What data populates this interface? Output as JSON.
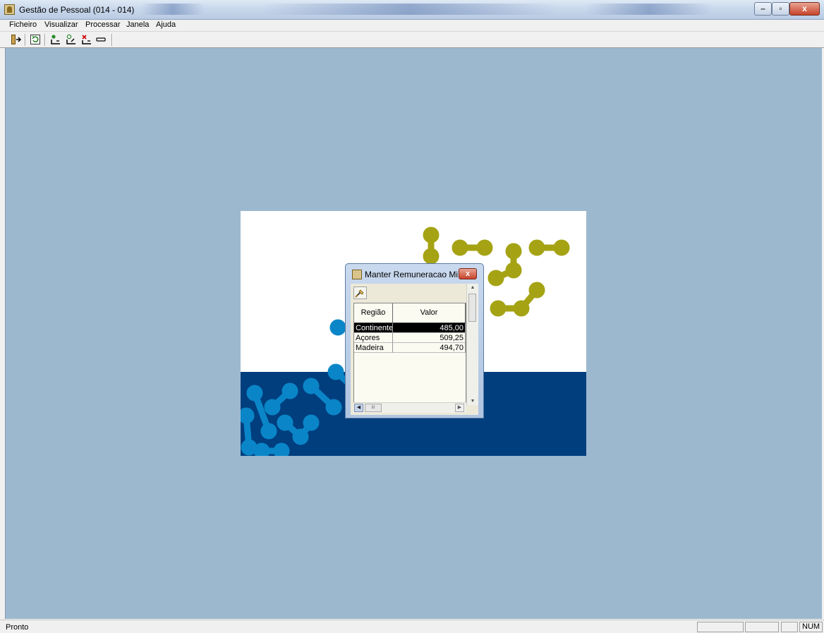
{
  "window": {
    "title": "Gestão de Pessoal (014 - 014)",
    "min_glyph": "–",
    "max_glyph": "▫",
    "close_glyph": "x"
  },
  "menu": [
    "Ficheiro",
    "Visualizar",
    "Processar",
    "Janela",
    "Ajuda"
  ],
  "toolbar": {
    "icons": [
      "exit-door-icon",
      "refresh-icon",
      "add-employee-icon",
      "edit-employee-icon",
      "delete-employee-icon",
      "minus-bar-icon"
    ]
  },
  "child_window": {
    "title": "Manter Remuneracao Mi...",
    "close_glyph": "x",
    "table": {
      "columns": [
        "Região",
        "Valor"
      ],
      "rows": [
        {
          "regiao": "Continente",
          "valor": "485,00",
          "selected": true
        },
        {
          "regiao": "Açores",
          "valor": "509,25",
          "selected": false
        },
        {
          "regiao": "Madeira",
          "valor": "494,70",
          "selected": false
        }
      ]
    },
    "hscroll_thumb": "III"
  },
  "status": {
    "text": "Pronto",
    "num": "NUM"
  },
  "colors": {
    "mdi_background": "#9cb8cf",
    "logo_navy": "#003e7e",
    "logo_blue": "#0a86c8",
    "logo_olive": "#a5a313"
  }
}
